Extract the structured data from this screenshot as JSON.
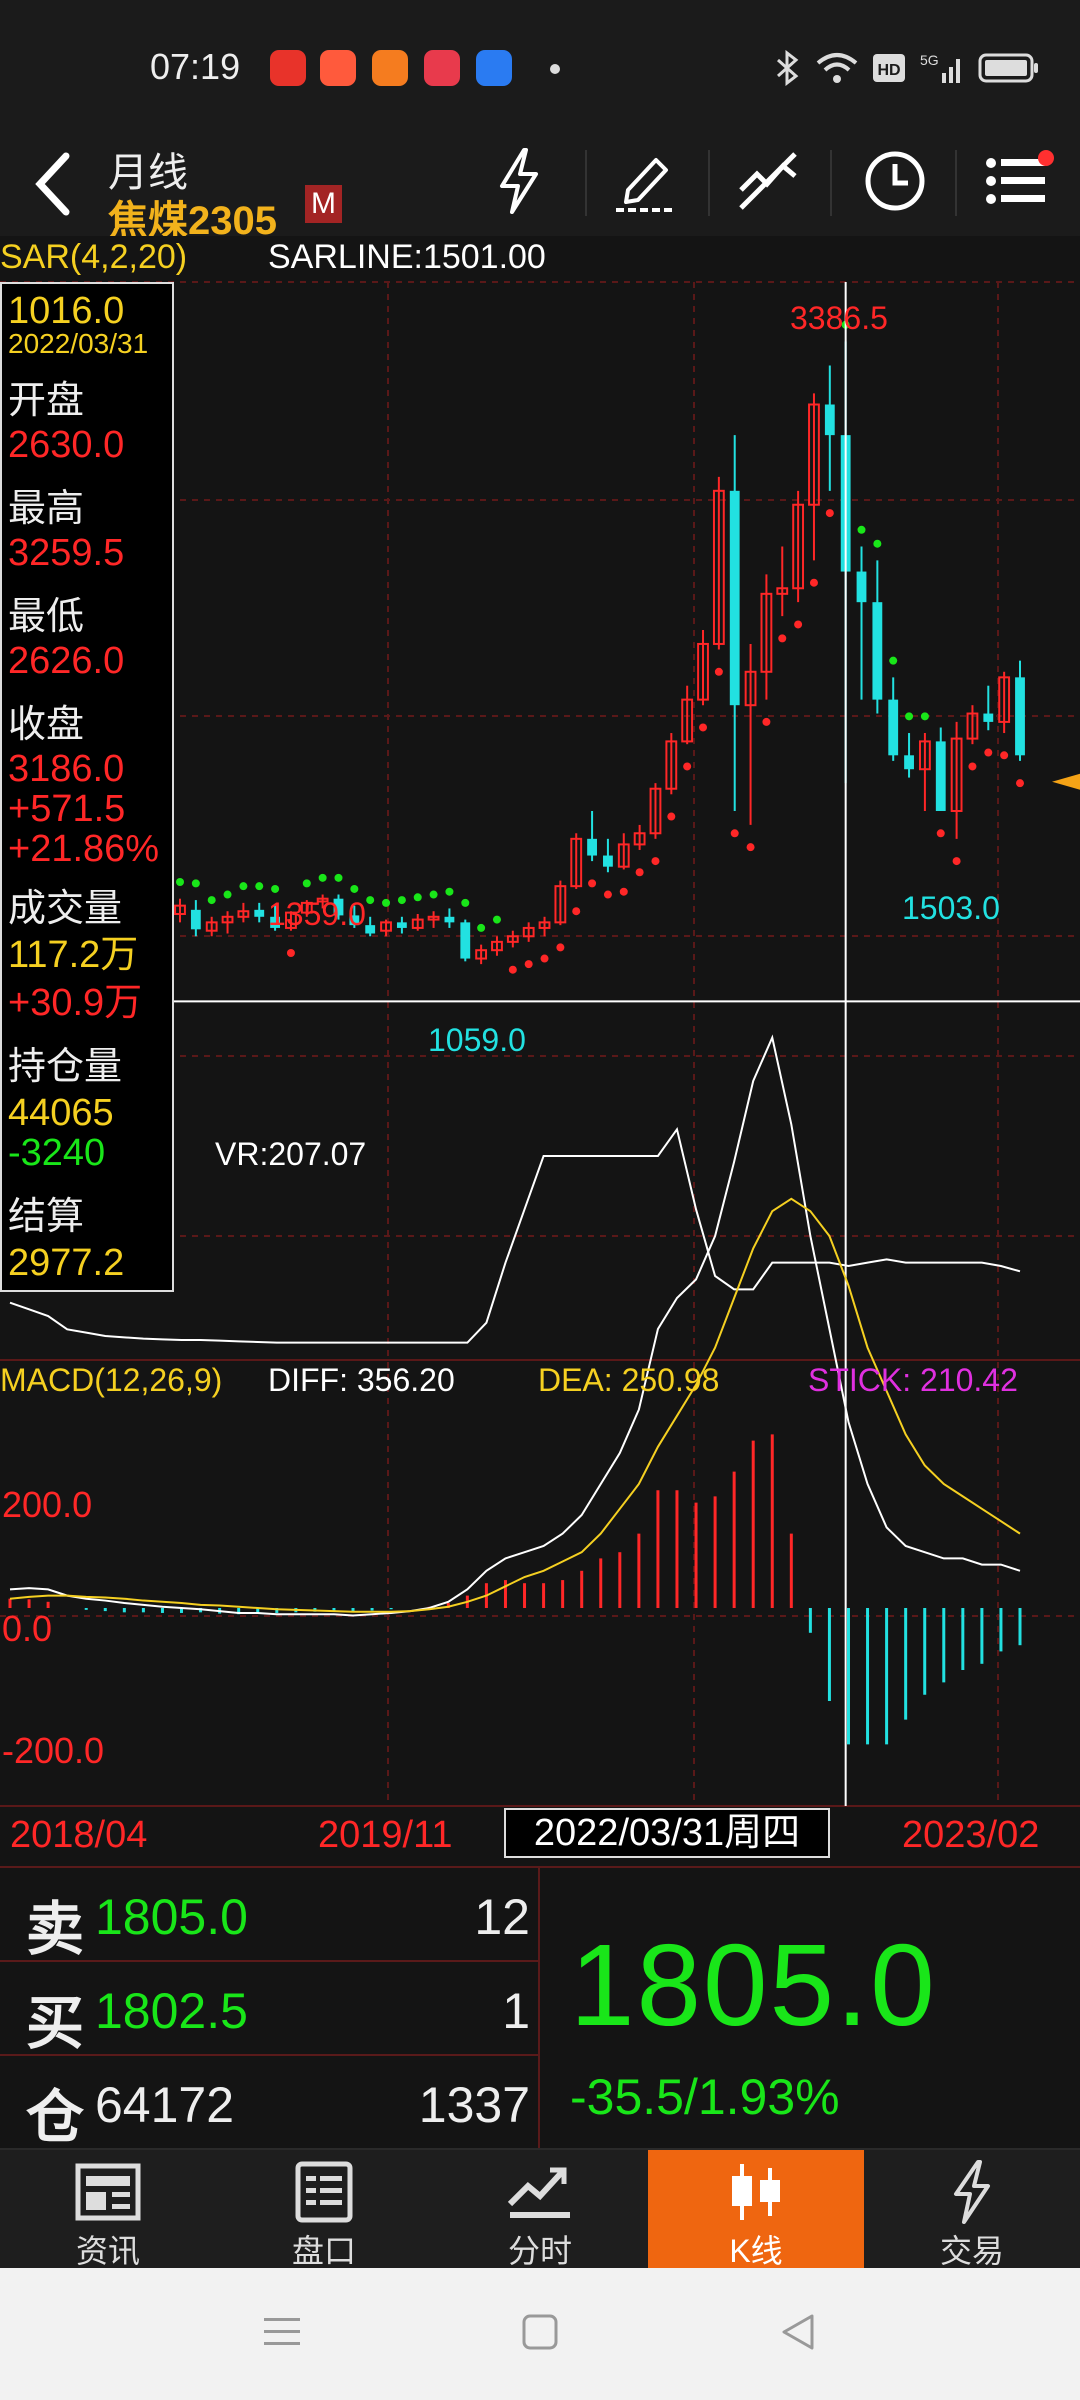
{
  "status": {
    "time": "07:19",
    "network": "5G"
  },
  "header": {
    "period": "月线",
    "name": "焦煤2305",
    "badge": "M"
  },
  "indicators": {
    "sar": "SAR(4,2,20)",
    "sarline": "SARLINE:1501.00",
    "vr": "VR:207.07"
  },
  "infobox": {
    "price": "1016.0",
    "date": "2022/03/31",
    "open_label": "开盘",
    "open": "2630.0",
    "high_label": "最高",
    "high": "3259.5",
    "low_label": "最低",
    "low": "2626.0",
    "close_label": "收盘",
    "close": "3186.0",
    "change": "+571.5",
    "change_pct": "+21.86%",
    "volume_label": "成交量",
    "volume": "117.2万",
    "volume_change": "+30.9万",
    "oi_label": "持仓量",
    "oi": "44065",
    "oi_change": "-3240",
    "settle_label": "结算",
    "settle": "2977.2"
  },
  "annotations": {
    "peak": "3386.5",
    "mid_high": "1359.0",
    "low1": "1059.0",
    "low2": "1503.0"
  },
  "macd": {
    "title": "MACD(12,26,9)",
    "diff": "DIFF: 356.20",
    "dea": "DEA: 250.98",
    "stick": "STICK: 210.42",
    "y_top": "200.0",
    "y_mid": "0.0",
    "y_bot": "-200.0"
  },
  "dates": {
    "left": "2018/04",
    "mid": "2019/11",
    "cursor": "2022/03/31周四",
    "right": "2023/02"
  },
  "quote": {
    "sell_label": "卖",
    "sell_price": "1805.0",
    "sell_vol": "12",
    "buy_label": "买",
    "buy_price": "1802.5",
    "buy_vol": "1",
    "oi_label": "仓",
    "oi": "64172",
    "oi_vol": "1337",
    "last": "1805.0",
    "change": "-35.5/1.93%"
  },
  "tabs": [
    {
      "label": "资讯",
      "icon": "news-icon"
    },
    {
      "label": "盘口",
      "icon": "orderbook-icon"
    },
    {
      "label": "分时",
      "icon": "intraday-icon"
    },
    {
      "label": "K线",
      "icon": "candlestick-icon",
      "active": true
    },
    {
      "label": "交易",
      "icon": "trade-icon"
    }
  ],
  "colors": {
    "up": "#ff2727",
    "down": "#22e1e1",
    "accent": "#ef6610",
    "sar_up": "#ff2727",
    "sar_down": "#19e619",
    "dea": "#f5d021"
  },
  "chart_data": {
    "type": "candlestick",
    "title": "焦煤2305 月线",
    "ylim": [
      820,
      3600
    ],
    "candles": [
      [
        1330,
        1385,
        1300,
        1360
      ],
      [
        1345,
        1380,
        1250,
        1275
      ],
      [
        1270,
        1320,
        1250,
        1300
      ],
      [
        1300,
        1340,
        1260,
        1320
      ],
      [
        1320,
        1370,
        1300,
        1340
      ],
      [
        1345,
        1370,
        1300,
        1320
      ],
      [
        1320,
        1360,
        1270,
        1280
      ],
      [
        1280,
        1340,
        1270,
        1335
      ],
      [
        1335,
        1380,
        1320,
        1370
      ],
      [
        1375,
        1400,
        1350,
        1385
      ],
      [
        1385,
        1400,
        1310,
        1325
      ],
      [
        1325,
        1360,
        1280,
        1290
      ],
      [
        1290,
        1320,
        1250,
        1260
      ],
      [
        1270,
        1310,
        1250,
        1300
      ],
      [
        1300,
        1320,
        1260,
        1280
      ],
      [
        1280,
        1330,
        1270,
        1310
      ],
      [
        1310,
        1340,
        1280,
        1320
      ],
      [
        1320,
        1350,
        1280,
        1300
      ],
      [
        1300,
        1310,
        1160,
        1170
      ],
      [
        1170,
        1220,
        1150,
        1200
      ],
      [
        1200,
        1250,
        1180,
        1230
      ],
      [
        1230,
        1270,
        1210,
        1250
      ],
      [
        1250,
        1300,
        1230,
        1280
      ],
      [
        1280,
        1320,
        1250,
        1300
      ],
      [
        1300,
        1450,
        1290,
        1430
      ],
      [
        1430,
        1620,
        1420,
        1600
      ],
      [
        1600,
        1700,
        1520,
        1540
      ],
      [
        1540,
        1600,
        1480,
        1500
      ],
      [
        1500,
        1620,
        1490,
        1580
      ],
      [
        1580,
        1650,
        1560,
        1620
      ],
      [
        1620,
        1800,
        1600,
        1780
      ],
      [
        1780,
        1980,
        1760,
        1950
      ],
      [
        1950,
        2150,
        1940,
        2100
      ],
      [
        2100,
        2350,
        2080,
        2300
      ],
      [
        2300,
        2900,
        2280,
        2850
      ],
      [
        2850,
        3050,
        1700,
        2080
      ],
      [
        2080,
        2300,
        1650,
        2200
      ],
      [
        2200,
        2550,
        2100,
        2480
      ],
      [
        2480,
        2650,
        2400,
        2500
      ],
      [
        2500,
        2850,
        2450,
        2800
      ],
      [
        2800,
        3200,
        2600,
        3160
      ],
      [
        3160,
        3300,
        2850,
        3050
      ],
      [
        3050,
        3386.5,
        1800,
        2560
      ],
      [
        2560,
        2650,
        2100,
        2450
      ],
      [
        2450,
        2600,
        2050,
        2100
      ],
      [
        2100,
        2180,
        1880,
        1900
      ],
      [
        1900,
        1980,
        1820,
        1850
      ],
      [
        1850,
        1980,
        1700,
        1950
      ],
      [
        1950,
        2000,
        1700,
        1700
      ],
      [
        1700,
        2020,
        1600,
        1960
      ],
      [
        1960,
        2080,
        1940,
        2050
      ],
      [
        2050,
        2150,
        1990,
        2020
      ],
      [
        2020,
        2200,
        1980,
        2180
      ],
      [
        2180,
        2240,
        1880,
        1900
      ]
    ],
    "sar_series": [
      {
        "name": "SAR",
        "values": "dots"
      }
    ],
    "vr": [
      160,
      150,
      140,
      120,
      115,
      110,
      108,
      106,
      105,
      104,
      104,
      103,
      102,
      101,
      100,
      100,
      100,
      100,
      100,
      100,
      100,
      100,
      100,
      100,
      100,
      130,
      220,
      300,
      380,
      380,
      380,
      380,
      380,
      380,
      380,
      420,
      300,
      200,
      180,
      180,
      220,
      220,
      220,
      220,
      215,
      220,
      225,
      220,
      220,
      220,
      220,
      220,
      215,
      207
    ],
    "macd": {
      "diff": [
        30,
        32,
        30,
        20,
        15,
        12,
        8,
        5,
        2,
        0,
        -2,
        -5,
        -8,
        -8,
        -10,
        -10,
        -10,
        -10,
        -12,
        -10,
        -8,
        -5,
        0,
        10,
        30,
        60,
        80,
        90,
        100,
        120,
        150,
        200,
        250,
        320,
        450,
        500,
        530,
        600,
        720,
        850,
        920,
        780,
        600,
        450,
        300,
        200,
        130,
        100,
        90,
        80,
        80,
        70,
        70,
        60
      ],
      "dea": [
        15,
        18,
        20,
        20,
        18,
        17,
        15,
        12,
        10,
        8,
        5,
        4,
        2,
        0,
        -2,
        -3,
        -4,
        -5,
        -6,
        -6,
        -6,
        -5,
        -2,
        2,
        10,
        20,
        35,
        50,
        60,
        75,
        90,
        120,
        160,
        200,
        260,
        310,
        360,
        420,
        500,
        580,
        640,
        660,
        640,
        600,
        520,
        420,
        350,
        280,
        230,
        200,
        180,
        160,
        140,
        120
      ]
    }
  }
}
